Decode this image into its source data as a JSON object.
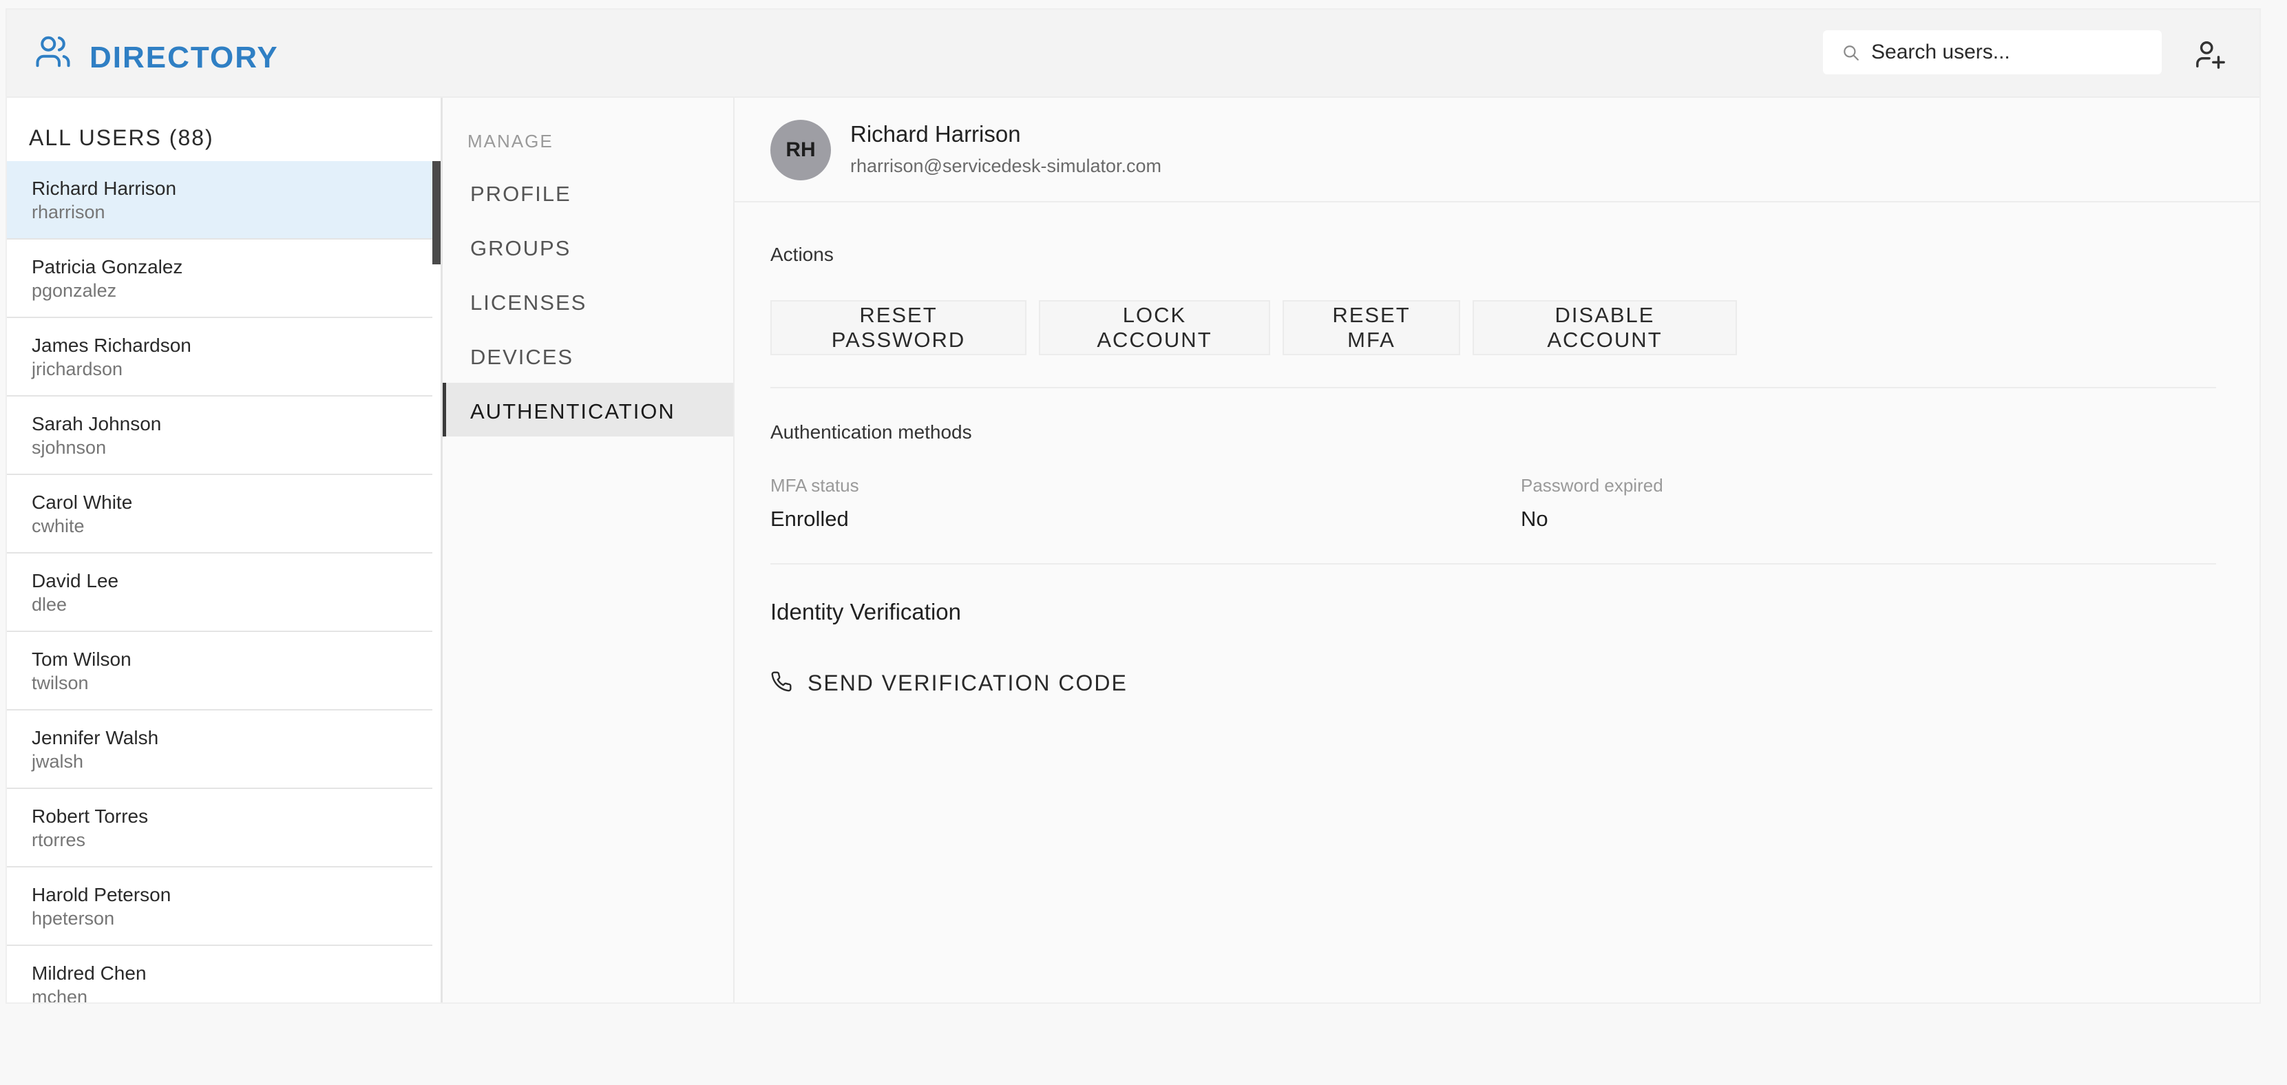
{
  "header": {
    "title": "DIRECTORY",
    "brand_icon": "users-icon",
    "search_placeholder": "Search users...",
    "add_user_icon": "user-plus-icon"
  },
  "user_list": {
    "header": "ALL USERS (88)",
    "users": [
      {
        "name": "Richard Harrison",
        "login": "rharrison",
        "selected": true
      },
      {
        "name": "Patricia Gonzalez",
        "login": "pgonzalez"
      },
      {
        "name": "James Richardson",
        "login": "jrichardson"
      },
      {
        "name": "Sarah Johnson",
        "login": "sjohnson"
      },
      {
        "name": "Carol White",
        "login": "cwhite"
      },
      {
        "name": "David Lee",
        "login": "dlee"
      },
      {
        "name": "Tom Wilson",
        "login": "twilson"
      },
      {
        "name": "Jennifer Walsh",
        "login": "jwalsh"
      },
      {
        "name": "Robert Torres",
        "login": "rtorres"
      },
      {
        "name": "Harold Peterson",
        "login": "hpeterson"
      },
      {
        "name": "Mildred Chen",
        "login": "mchen"
      }
    ]
  },
  "manage": {
    "label": "MANAGE",
    "items": [
      {
        "label": "PROFILE"
      },
      {
        "label": "GROUPS"
      },
      {
        "label": "LICENSES"
      },
      {
        "label": "DEVICES"
      },
      {
        "label": "AUTHENTICATION",
        "active": true
      }
    ]
  },
  "detail": {
    "avatar_initials": "RH",
    "name": "Richard Harrison",
    "email": "rharrison@servicedesk-simulator.com",
    "actions_title": "Actions",
    "actions": [
      {
        "label": "RESET PASSWORD"
      },
      {
        "label": "LOCK ACCOUNT"
      },
      {
        "label": "RESET MFA"
      },
      {
        "label": "DISABLE ACCOUNT"
      }
    ],
    "auth_title": "Authentication methods",
    "mfa_status_label": "MFA status",
    "mfa_status_value": "Enrolled",
    "password_expired_label": "Password expired",
    "password_expired_value": "No",
    "identity_title": "Identity Verification",
    "send_code_label": "SEND VERIFICATION CODE",
    "send_code_icon": "phone-icon"
  },
  "colors": {
    "brand": "#2f7fc4",
    "selected_row": "#e3f0fa",
    "avatar": "#9e9ea4"
  }
}
